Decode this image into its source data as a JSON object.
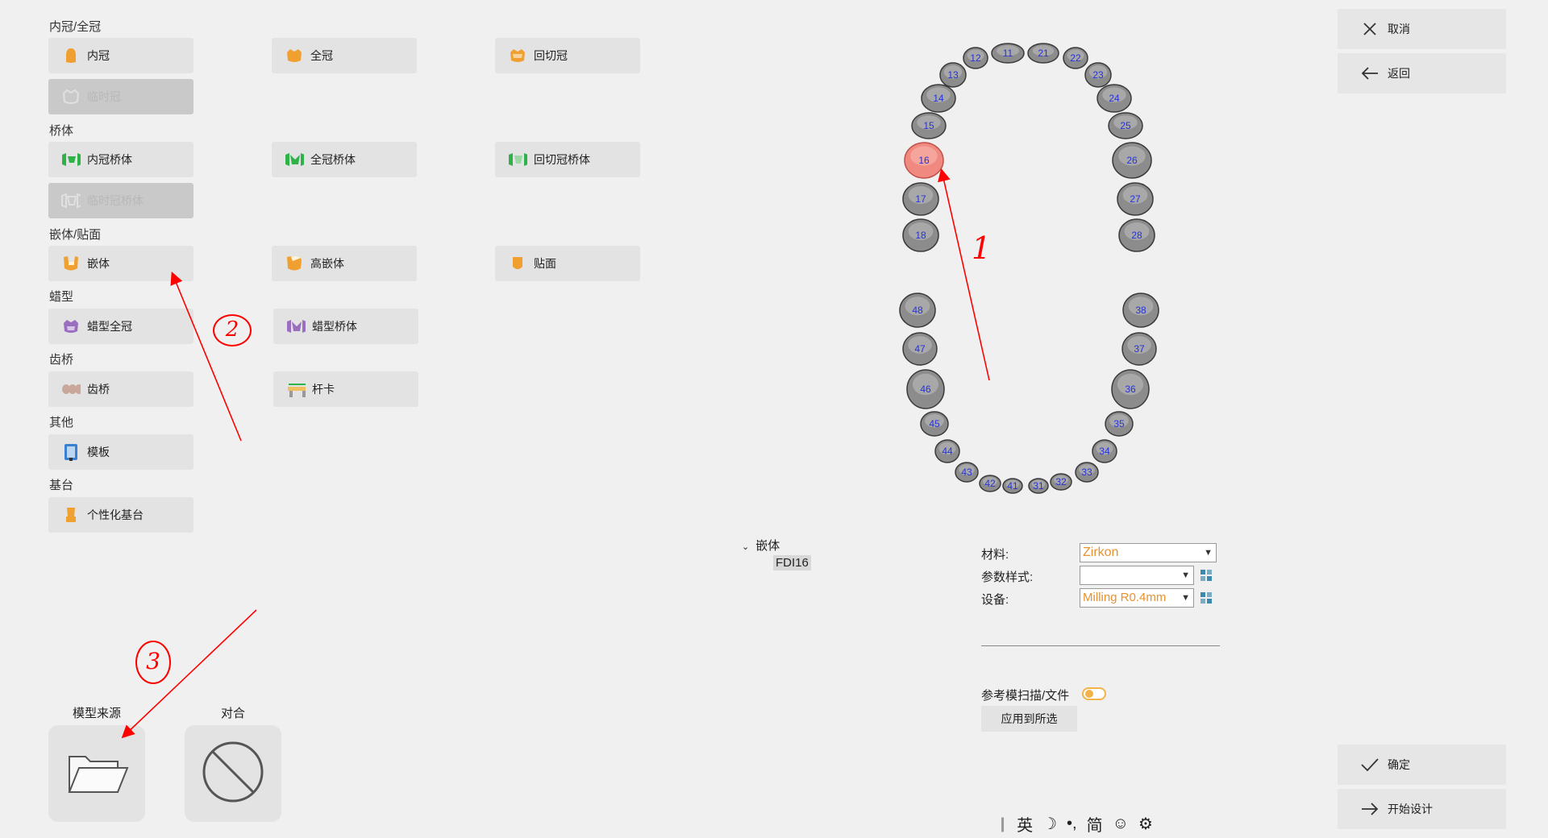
{
  "groups": {
    "crown": "内冠/全冠",
    "bridge": "桥体",
    "inlay": "嵌体/贴面",
    "wax": "蜡型",
    "bridge2": "齿桥",
    "other": "其他",
    "abutment": "基台"
  },
  "types": {
    "coping": "内冠",
    "full_crown": "全冠",
    "cutback_crown": "回切冠",
    "temp_crown": "临时冠",
    "coping_bridge": "内冠桥体",
    "full_crown_bridge": "全冠桥体",
    "cutback_bridge": "回切冠桥体",
    "temp_bridge": "临时冠桥体",
    "inlay": "嵌体",
    "onlay": "高嵌体",
    "veneer": "贴面",
    "wax_crown": "蜡型全冠",
    "wax_bridge": "蜡型桥体",
    "tooth_bridge": "齿桥",
    "bar": "杆卡",
    "template": "模板",
    "custom_abutment": "个性化基台"
  },
  "bottom": {
    "model_source": "模型来源",
    "antagonist": "对合"
  },
  "teeth": {
    "upper_right": [
      "18",
      "17",
      "16",
      "15",
      "14",
      "13",
      "12",
      "11"
    ],
    "upper_left": [
      "21",
      "22",
      "23",
      "24",
      "25",
      "26",
      "27",
      "28"
    ],
    "lower_right": [
      "48",
      "47",
      "46",
      "45",
      "44",
      "43",
      "42",
      "41"
    ],
    "lower_left": [
      "31",
      "32",
      "33",
      "34",
      "35",
      "36",
      "37",
      "38"
    ],
    "selected": "16"
  },
  "tree": {
    "group": "嵌体",
    "item": "FDI16"
  },
  "props": {
    "material_label": "材料:",
    "material_value": "Zirkon",
    "param_label": "参数样式:",
    "param_value": "",
    "device_label": "设备:",
    "device_value": "Milling R0.4mm",
    "ref_scan_label": "参考模扫描/文件",
    "apply_label": "应用到所选"
  },
  "actions": {
    "cancel": "取消",
    "back": "返回",
    "confirm": "确定",
    "start_design": "开始设计"
  },
  "ime": [
    "英",
    "☽",
    "•,",
    "简",
    "☺",
    "⚙"
  ],
  "annotations": [
    "1",
    "2",
    "3"
  ],
  "colors": {
    "accent": "#e8912e",
    "selected_tooth": "#f08a80",
    "arrow": "#ff0000"
  }
}
